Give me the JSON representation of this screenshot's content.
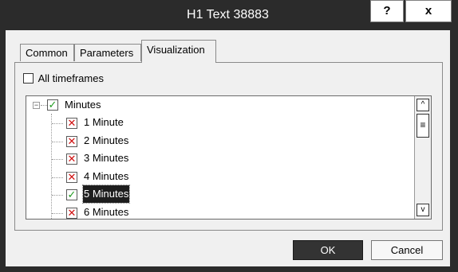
{
  "window": {
    "title": "H1 Text 38883",
    "help_label": "?",
    "close_label": "x"
  },
  "tabs": [
    {
      "label": "Common",
      "active": false
    },
    {
      "label": "Parameters",
      "active": false
    },
    {
      "label": "Visualization",
      "active": true
    }
  ],
  "visualization": {
    "all_timeframes": {
      "label": "All timeframes",
      "checked": false
    },
    "tree": {
      "root": {
        "label": "Minutes",
        "expander": "−",
        "state": "checked"
      },
      "items": [
        {
          "label": "1 Minute",
          "state": "x"
        },
        {
          "label": "2 Minutes",
          "state": "x"
        },
        {
          "label": "3 Minutes",
          "state": "x"
        },
        {
          "label": "4 Minutes",
          "state": "x"
        },
        {
          "label": "5 Minutes",
          "state": "checked",
          "selected": true
        },
        {
          "label": "6 Minutes",
          "state": "x"
        }
      ]
    },
    "scrollbar": {
      "up": "^",
      "down": "v",
      "thumb": "≡"
    }
  },
  "buttons": {
    "ok": "OK",
    "cancel": "Cancel"
  },
  "colors": {
    "check_green": "#1f9a1f",
    "x_red": "#d01010",
    "titlebar": "#2b2b2b",
    "ok_button": "#333333"
  }
}
